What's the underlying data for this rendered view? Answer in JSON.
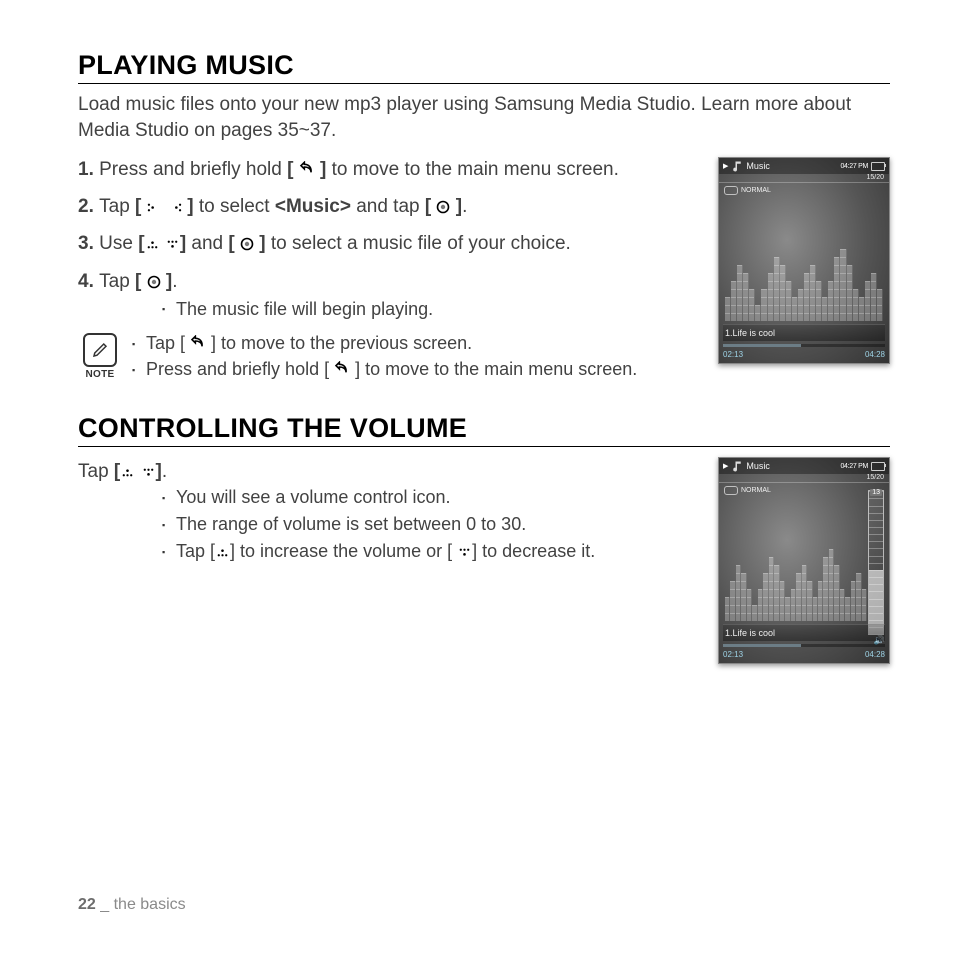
{
  "heading1": "PLAYING MUSIC",
  "intro": "Load music files onto your new mp3 player using Samsung Media Studio. Learn more about Media Studio on pages 35~37.",
  "steps": {
    "s1_a": "Press and briefly hold ",
    "s1_b": " to move to the main menu screen.",
    "s2_a": "Tap ",
    "s2_b": " to select ",
    "s2_music": "<Music>",
    "s2_c": " and tap ",
    "s2_d": ".",
    "s3_a": "Use ",
    "s3_b": " and ",
    "s3_c": " to select a music file of your choice.",
    "s4_a": "Tap ",
    "s4_b": ".",
    "s4_sub": "The music file will begin playing."
  },
  "note_label": "NOTE",
  "notes": {
    "n1_a": "Tap [ ",
    "n1_b": " ] to move to the previous screen.",
    "n2_a": "Press and briefly hold [ ",
    "n2_b": " ] to move to the main menu screen."
  },
  "heading2": "CONTROLLING THE VOLUME",
  "tap_a": "Tap ",
  "tap_b": ".",
  "vol_bullets": {
    "b1": "You will see a volume control icon.",
    "b2": "The range of volume is set between 0 to 30.",
    "b3_a": "Tap [",
    "b3_b": "] to increase the volume or [",
    "b3_c": "] to decrease it."
  },
  "device": {
    "app": "Music",
    "clock": "04:27 PM",
    "count": "15/20",
    "mode": "NORMAL",
    "song": "1.Life is cool",
    "elapsed": "02:13",
    "total": "04:28",
    "vol_value": "13",
    "eq_heights": [
      3,
      5,
      7,
      6,
      4,
      2,
      4,
      6,
      8,
      7,
      5,
      3,
      4,
      6,
      7,
      5,
      3,
      5,
      8,
      9,
      7,
      4,
      3,
      5,
      6,
      4
    ]
  },
  "footer": {
    "page": "22",
    "sep": " _ ",
    "section": "the basics"
  }
}
